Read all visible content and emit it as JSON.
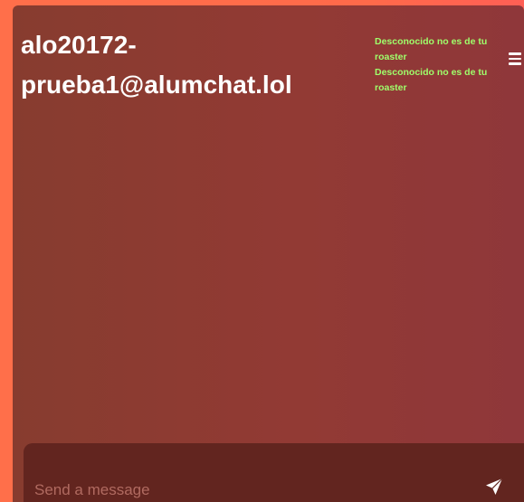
{
  "chat": {
    "title": "alo20172-prueba1@alumchat.lol"
  },
  "notifications": [
    {
      "text": "Desconocido no es de tu roaster"
    },
    {
      "text": "Desconocido no es de tu roaster"
    }
  ],
  "menu": {
    "icon": "hamburger-menu-icon"
  },
  "composer": {
    "placeholder": "Send a message",
    "send_icon": "paper-plane-icon"
  },
  "colors": {
    "background": "#ff6f4a",
    "panel": "#8f3a33",
    "composer": "#62251f",
    "notification_text": "#9fff6b",
    "title_text": "#ffffff"
  }
}
